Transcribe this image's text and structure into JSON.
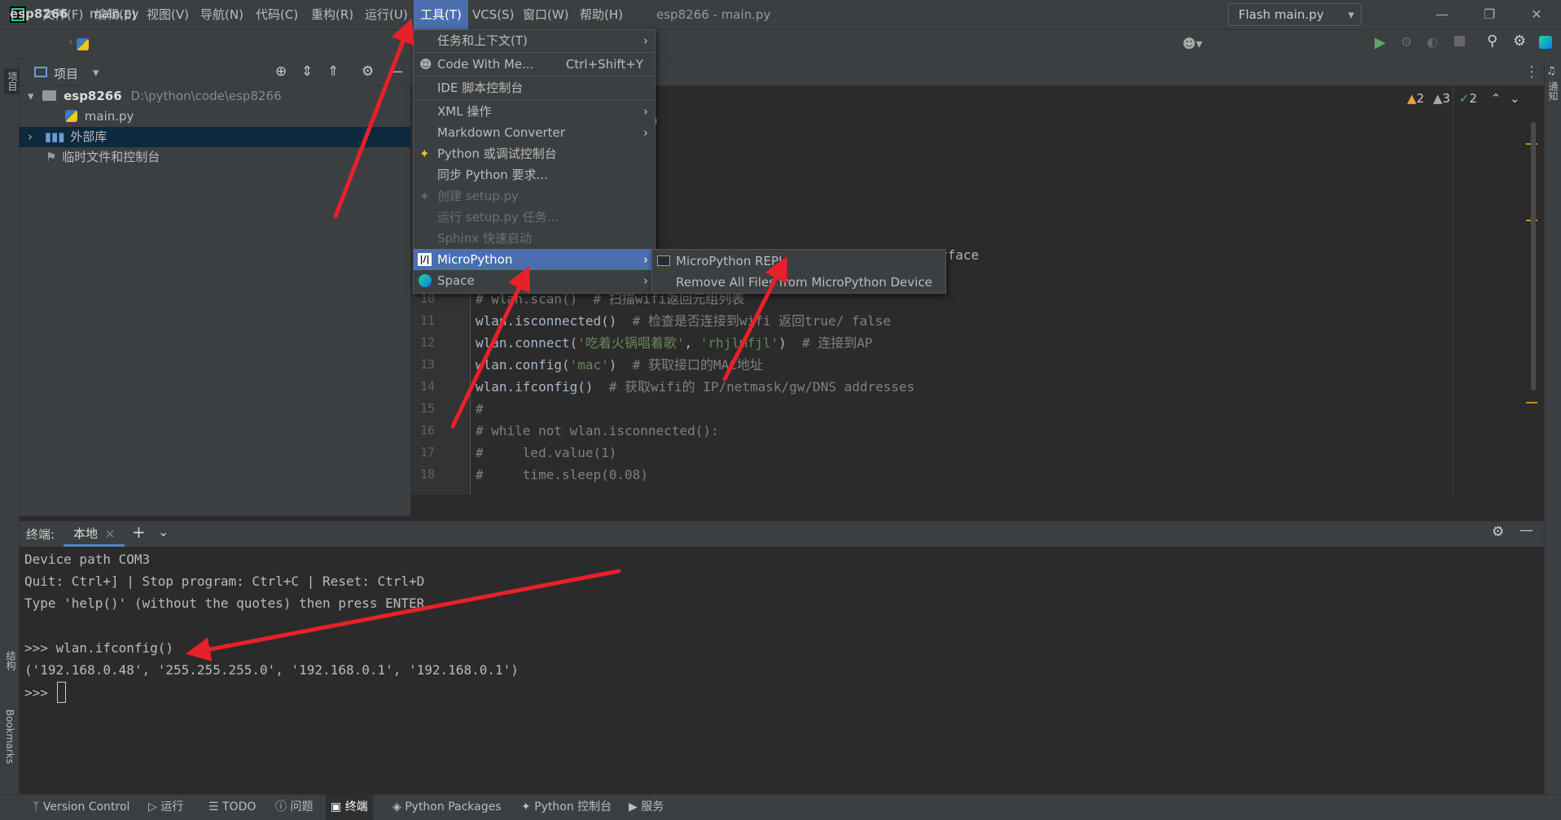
{
  "titlebar": {
    "menus": [
      "文件(F)",
      "编辑(E)",
      "视图(V)",
      "导航(N)",
      "代码(C)",
      "重构(R)",
      "运行(U)",
      "工具(T)",
      "VCS(S)",
      "窗口(W)",
      "帮助(H)"
    ],
    "active_menu": "工具(T)",
    "window_title": "esp8266 - main.py"
  },
  "navbar": {
    "project": "esp8266",
    "file": "main.py",
    "run_config": "Flash main.py"
  },
  "project_panel": {
    "title": "项目",
    "tree": [
      {
        "label": "esp8266",
        "path": "D:\\python\\code\\esp8266"
      },
      {
        "label": "main.py"
      },
      {
        "label": "外部库"
      },
      {
        "label": "临时文件和控制台"
      }
    ]
  },
  "left_stripe": {
    "top": "项目",
    "structure": "结构",
    "bookmarks": "Bookmarks"
  },
  "right_stripe": {
    "notifications": "通知"
  },
  "inspections": {
    "warn1": "2",
    "warn2": "3",
    "ok": "2"
  },
  "tools_menu": {
    "items": [
      {
        "label": "任务和上下文(T)",
        "submenu": true
      },
      {
        "label": "Code With Me...",
        "shortcut": "Ctrl+Shift+Y"
      },
      {
        "label": "IDE 脚本控制台"
      },
      {
        "label": "XML 操作",
        "submenu": true
      },
      {
        "label": "Markdown Converter",
        "submenu": true
      },
      {
        "label": "Python 或调试控制台"
      },
      {
        "label": "同步 Python 要求..."
      },
      {
        "label": "创建 setup.py",
        "disabled": true
      },
      {
        "label": "运行 setup.py 任务...",
        "disabled": true
      },
      {
        "label": "Sphinx 快速启动",
        "disabled": true
      },
      {
        "label": "MicroPython",
        "submenu": true,
        "highlighted": true
      },
      {
        "label": "Space",
        "submenu": true
      }
    ]
  },
  "micropython_submenu": {
    "items": [
      {
        "label": "MicroPython REPL"
      },
      {
        "label": "Remove All Files from MicroPython Device"
      }
    ]
  },
  "editor": {
    "partial_fragments": [
      "n",
      "rface"
    ],
    "lines": [
      {
        "no": "10",
        "code": "# wlan.scan()  # 扫描wifi返回元组列表"
      },
      {
        "no": "11",
        "code": "wlan.isconnected()",
        "comment": "  # 检查是否连接到wifi 返回true/ false"
      },
      {
        "no": "12",
        "code_pre": "wlan.connect(",
        "str1": "'吃着火锅唱着歌'",
        "mid": ", ",
        "str2": "'rhjlmfjl'",
        "code_post": ")",
        "comment": "  # 连接到AP"
      },
      {
        "no": "13",
        "code_pre": "wlan.config(",
        "str1": "'mac'",
        "code_post": ")",
        "comment": "  # 获取接口的MAC地址"
      },
      {
        "no": "14",
        "code": "wlan.ifconfig()",
        "comment": "  # 获取wifi的 IP/netmask/gw/DNS addresses"
      },
      {
        "no": "15",
        "code": "#"
      },
      {
        "no": "16",
        "code": "# while not wlan.isconnected():"
      },
      {
        "no": "17",
        "code": "#     led.value(1)"
      },
      {
        "no": "18",
        "code": "#     time.sleep(0.08)"
      }
    ]
  },
  "terminal": {
    "label": "终端:",
    "tab": "本地",
    "lines": [
      "Device path COM3",
      "Quit: Ctrl+] | Stop program: Ctrl+C | Reset: Ctrl+D",
      "Type 'help()' (without the quotes) then press ENTER.",
      "",
      ">>> wlan.ifconfig()",
      "('192.168.0.48', '255.255.255.0', '192.168.0.1', '192.168.0.1')",
      ">>> "
    ]
  },
  "bottom_tools": [
    "Version Control",
    "运行",
    "TODO",
    "问题",
    "终端",
    "Python Packages",
    "Python 控制台",
    "服务"
  ],
  "colors": {
    "accent": "#4b6eaf",
    "annotation_arrow": "#e8202a",
    "run_green": "#59a869"
  }
}
